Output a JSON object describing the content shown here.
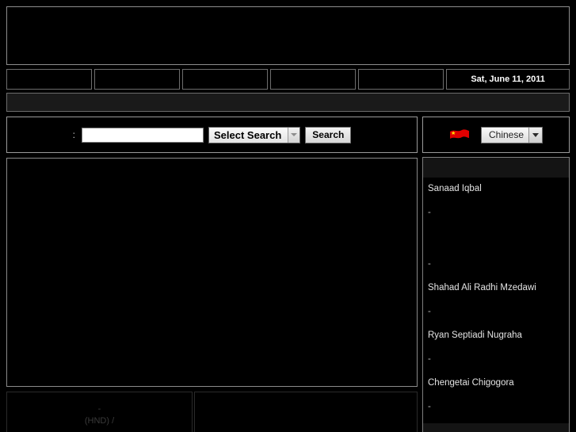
{
  "banner": {
    "alt": "site-banner"
  },
  "nav": {
    "items": [
      {
        "label": ""
      },
      {
        "label": ""
      },
      {
        "label": ""
      },
      {
        "label": ""
      },
      {
        "label": ""
      }
    ],
    "date": "Sat, June 11, 2011"
  },
  "subbar": {
    "label": ""
  },
  "search": {
    "colon_label": ":",
    "input_value": "",
    "input_placeholder": "",
    "select_value": "Select Search",
    "select_options": [
      "Select Search"
    ],
    "button_label": "Search"
  },
  "language": {
    "flag": "chinese-flag-icon",
    "flag_colors": {
      "field": "#e00000",
      "star": "#ffde00"
    },
    "select_value": "Chinese",
    "select_options": [
      "Chinese"
    ]
  },
  "main": {
    "content": ""
  },
  "bottom": {
    "cell_a": {
      "line1": "-",
      "line2": "(HND)  /"
    },
    "cell_b": {
      "content": ""
    }
  },
  "names_panel": {
    "header": "",
    "items": [
      {
        "text": "Sanaad Iqbal",
        "type": "name"
      },
      {
        "text": "-",
        "type": "dash"
      },
      {
        "text": "-",
        "type": "dash"
      },
      {
        "text": "Shahad Ali Radhi Mzedawi",
        "type": "name"
      },
      {
        "text": "-",
        "type": "dash"
      },
      {
        "text": "Ryan Septiadi Nugraha",
        "type": "name"
      },
      {
        "text": "-",
        "type": "dash"
      },
      {
        "text": "Chengetai Chigogora",
        "type": "name"
      },
      {
        "text": "-",
        "type": "dash"
      }
    ],
    "footer": ""
  },
  "colors": {
    "page_background": "#000000",
    "border_light": "#8d8d8d",
    "border_dim": "#6d6d6d",
    "subbar_background": "#1a1a1a",
    "text_primary": "#ffffff",
    "text_muted": "#3a3a3a"
  }
}
